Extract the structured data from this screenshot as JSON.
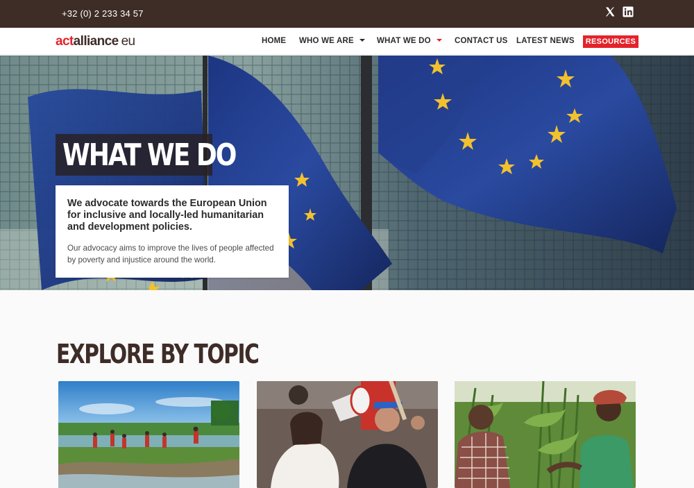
{
  "topbar": {
    "phone": "+32 (0) 2 233 34 57",
    "social_icons": [
      "x-icon",
      "linkedin-icon"
    ]
  },
  "logo": {
    "act": "act",
    "alliance": "alliance",
    "eu": "eu"
  },
  "nav": {
    "home": "HOME",
    "who_we_are": "WHO WE ARE",
    "what_we_do": "WHAT WE DO",
    "contact_us": "CONTACT US",
    "latest_news": "LATEST NEWS",
    "resources": "RESOURCES"
  },
  "hero": {
    "title": "WHAT WE DO",
    "lead": "We advocate towards the European Union for inclusive and locally-led humanitarian and development policies.",
    "sub": "Our advocacy aims to improve the lives of people affected by poverty and injustice around the world."
  },
  "explore": {
    "heading": "EXPLORE BY TOPIC",
    "cards": [
      "children-field-photo",
      "protest-megaphone-photo",
      "maize-farmers-photo"
    ]
  },
  "colors": {
    "brand_red": "#e3232b",
    "brand_brown": "#3e2c27",
    "eu_blue": "#1f3a8a",
    "eu_star": "#f2c12e"
  }
}
